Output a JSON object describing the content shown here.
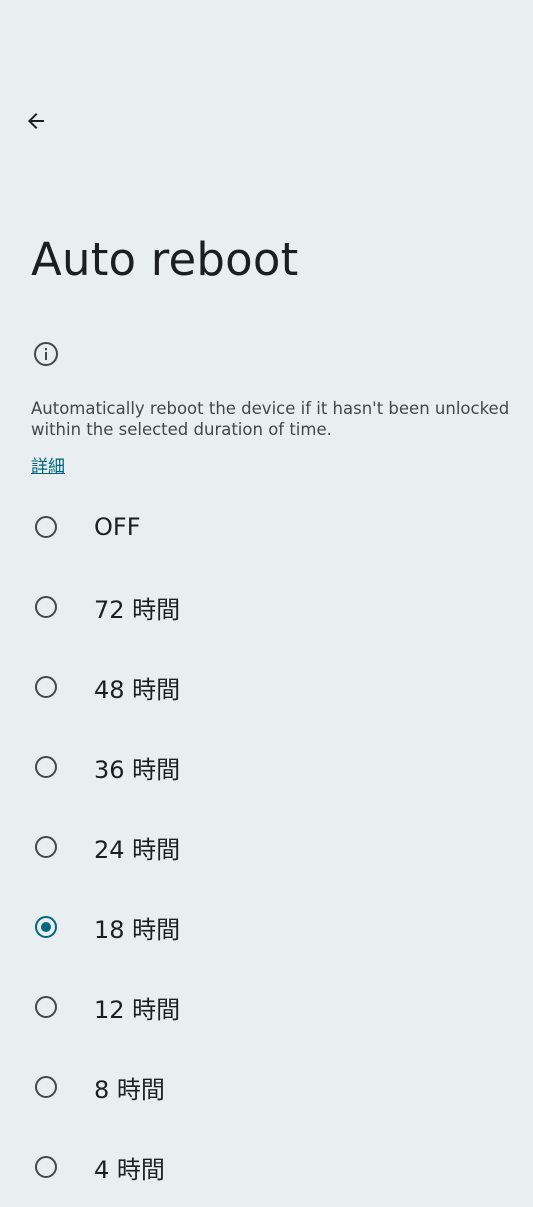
{
  "header": {
    "back_icon": "arrow-back-icon",
    "title": "Auto reboot"
  },
  "info": {
    "icon": "info-icon",
    "description": "Automatically reboot the device if it hasn't been unlocked within the selected duration of time.",
    "learn_more": "詳細"
  },
  "colors": {
    "background": "#e9eef1",
    "accent": "#00677e",
    "text_primary": "#1b1f22",
    "text_secondary": "#41484d"
  },
  "options": [
    {
      "label": "OFF",
      "selected": false
    },
    {
      "label": "72 時間",
      "selected": false
    },
    {
      "label": "48 時間",
      "selected": false
    },
    {
      "label": "36 時間",
      "selected": false
    },
    {
      "label": "24 時間",
      "selected": false
    },
    {
      "label": "18 時間",
      "selected": true
    },
    {
      "label": "12 時間",
      "selected": false
    },
    {
      "label": "8 時間",
      "selected": false
    },
    {
      "label": "4 時間",
      "selected": false
    }
  ]
}
